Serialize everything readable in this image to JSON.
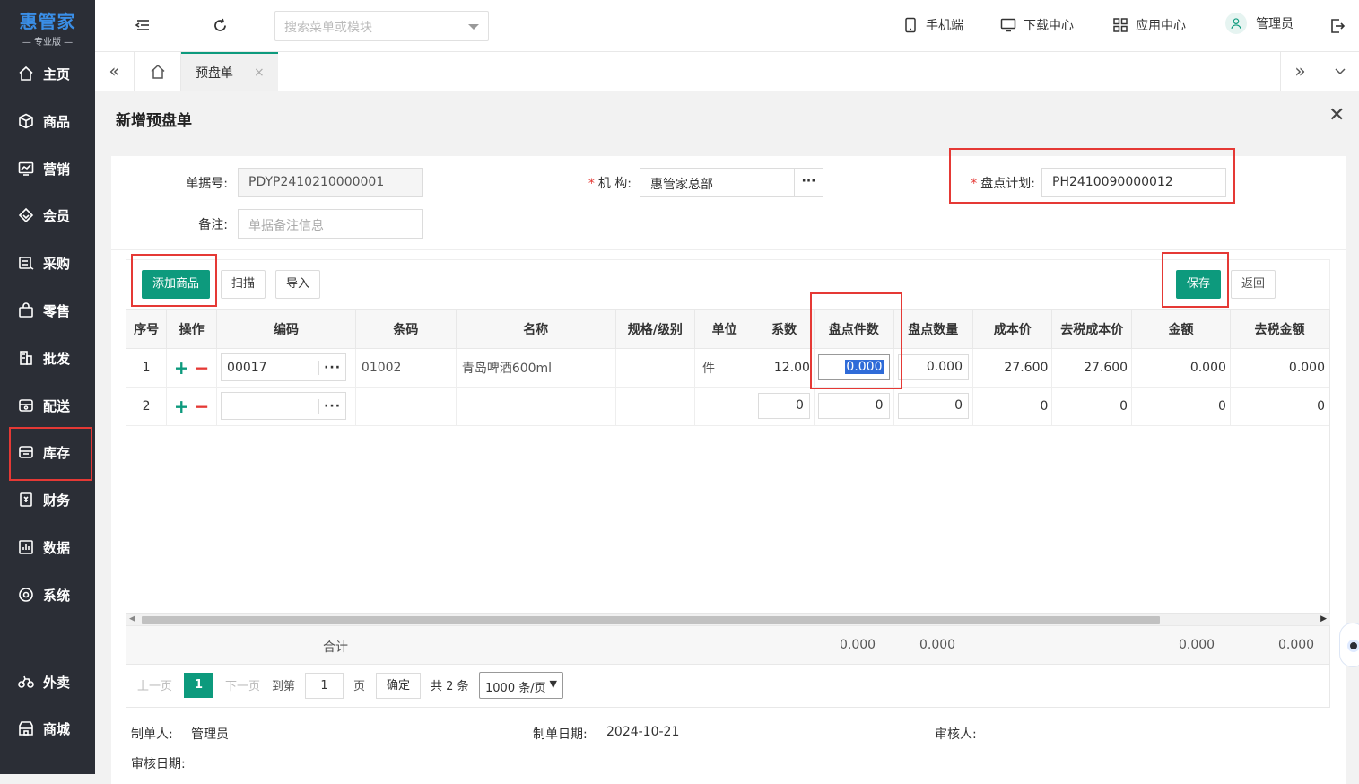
{
  "app": {
    "logo_title": "惠管家",
    "logo_sub": "— 专业版 —"
  },
  "sidebar": {
    "items": [
      {
        "label": "主页",
        "icon": "home-icon"
      },
      {
        "label": "商品",
        "icon": "cube-icon"
      },
      {
        "label": "营销",
        "icon": "chart-screen-icon"
      },
      {
        "label": "会员",
        "icon": "diamond-icon"
      },
      {
        "label": "采购",
        "icon": "purchase-icon"
      },
      {
        "label": "零售",
        "icon": "bag-icon"
      },
      {
        "label": "批发",
        "icon": "building-icon"
      },
      {
        "label": "配送",
        "icon": "truck-icon"
      },
      {
        "label": "库存",
        "icon": "box-icon"
      },
      {
        "label": "财务",
        "icon": "finance-icon"
      },
      {
        "label": "数据",
        "icon": "data-icon"
      },
      {
        "label": "系统",
        "icon": "settings-icon"
      },
      {
        "label": "外卖",
        "icon": "bike-icon"
      },
      {
        "label": "商城",
        "icon": "store-icon"
      }
    ]
  },
  "header": {
    "search_placeholder": "搜索菜单或模块",
    "tools": {
      "mobile": "手机端",
      "download": "下载中心",
      "apps": "应用中心",
      "user": "管理员"
    }
  },
  "tabs": {
    "active": "预盘单"
  },
  "page": {
    "title": "新增预盘单"
  },
  "form": {
    "doc_no_label": "单据号:",
    "doc_no_value": "PDYP2410210000001",
    "org_label": "机 构:",
    "org_value": "惠管家总部",
    "plan_label": "盘点计划:",
    "plan_value": "PH2410090000012",
    "remark_label": "备注:",
    "remark_placeholder": "单据备注信息"
  },
  "toolbar": {
    "add_goods": "添加商品",
    "scan": "扫描",
    "import": "导入",
    "save": "保存",
    "back": "返回"
  },
  "table": {
    "headers": [
      "序号",
      "操作",
      "编码",
      "条码",
      "名称",
      "规格/级别",
      "单位",
      "系数",
      "盘点件数",
      "盘点数量",
      "成本价",
      "去税成本价",
      "金额",
      "去税金额"
    ],
    "rows": [
      {
        "no": "1",
        "code": "00017",
        "barcode": "01002",
        "name": "青岛啤酒600ml",
        "spec": "",
        "unit": "件",
        "factor": "12.00",
        "pieces": "0.000",
        "qty": "0.000",
        "cost": "27.600",
        "cost_notax": "27.600",
        "amount": "0.000",
        "amount_notax": "0.000"
      },
      {
        "no": "2",
        "code": "",
        "barcode": "",
        "name": "",
        "spec": "",
        "unit": "",
        "factor": "0",
        "pieces": "0",
        "qty": "0",
        "cost": "0",
        "cost_notax": "0",
        "amount": "0",
        "amount_notax": "0"
      }
    ],
    "sum_label": "合计",
    "sums": {
      "pieces": "0.000",
      "qty": "0.000",
      "amount": "0.000",
      "amount_notax": "0.000"
    }
  },
  "pager": {
    "prev": "上一页",
    "current": "1",
    "next": "下一页",
    "goto": "到第",
    "page_value": "1",
    "page_unit": "页",
    "confirm": "确定",
    "total": "共 2 条",
    "page_size": "1000 条/页"
  },
  "footer": {
    "maker_label": "制单人:",
    "maker": "管理员",
    "date_label": "制单日期:",
    "date": "2024-10-21",
    "auditor_label": "审核人:",
    "audit_date_label": "审核日期:"
  },
  "colors": {
    "primary": "#0d9a7d",
    "sidebar_bg": "#2b2e36",
    "highlight_box": "#e53935",
    "logo": "#3a8ee6"
  }
}
